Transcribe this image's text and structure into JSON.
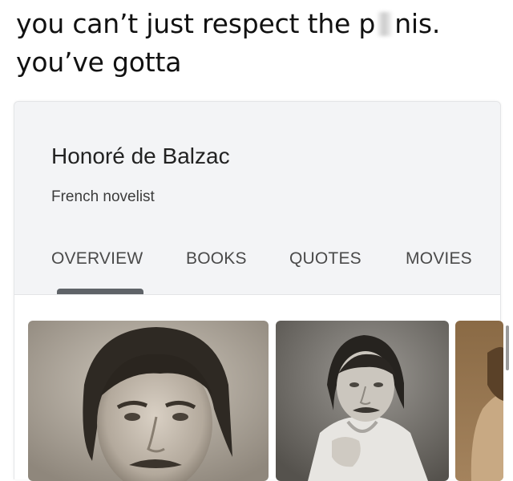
{
  "caption": {
    "line1_before": "you can’t just respect the p",
    "line1_after": "nis.",
    "line2": "you’ve gotta"
  },
  "panel": {
    "title": "Honoré de Balzac",
    "subtitle": "French novelist",
    "tabs": [
      {
        "label": "OVERVIEW",
        "selected": true
      },
      {
        "label": "BOOKS",
        "selected": false
      },
      {
        "label": "QUOTES",
        "selected": false
      },
      {
        "label": "MOVIES",
        "selected": false
      }
    ]
  },
  "photos": [
    {
      "icon": "portrait-photo"
    },
    {
      "icon": "portrait-photo"
    },
    {
      "icon": "portrait-photo"
    }
  ],
  "colors": {
    "card_background": "#f3f4f6",
    "tab_indicator": "#5f6368",
    "text_primary": "#222222"
  }
}
